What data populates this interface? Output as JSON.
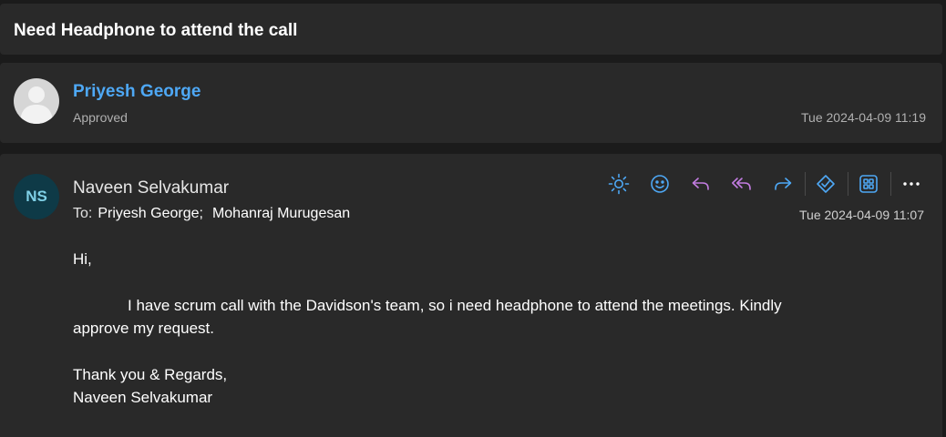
{
  "subject": "Need Headphone to attend the call",
  "approval": {
    "name": "Priyesh George",
    "status": "Approved",
    "date": "Tue 2024-04-09 11:19"
  },
  "message": {
    "sender_initials": "NS",
    "sender_name": "Naveen Selvakumar",
    "to_label": "To:",
    "recipients": [
      "Priyesh George;",
      "Mohanraj Murugesan"
    ],
    "date": "Tue 2024-04-09 11:07",
    "body": {
      "greeting": "Hi,",
      "paragraph_line1": "I have scrum call  with the Davidson's team, so i need headphone to attend the meetings. Kindly",
      "paragraph_line2": "approve my request.",
      "signoff": "Thank you & Regards,",
      "signature": "Naveen Selvakumar"
    }
  },
  "toolbar": {
    "icons": [
      "sun-icon",
      "emoji-icon",
      "reply-icon",
      "reply-all-icon",
      "forward-icon",
      "immersive-reader-icon",
      "apps-icon",
      "more-icon"
    ],
    "colors": {
      "blue": "#4ea8f5",
      "purple": "#c27ce0",
      "white": "#ffffff"
    }
  }
}
